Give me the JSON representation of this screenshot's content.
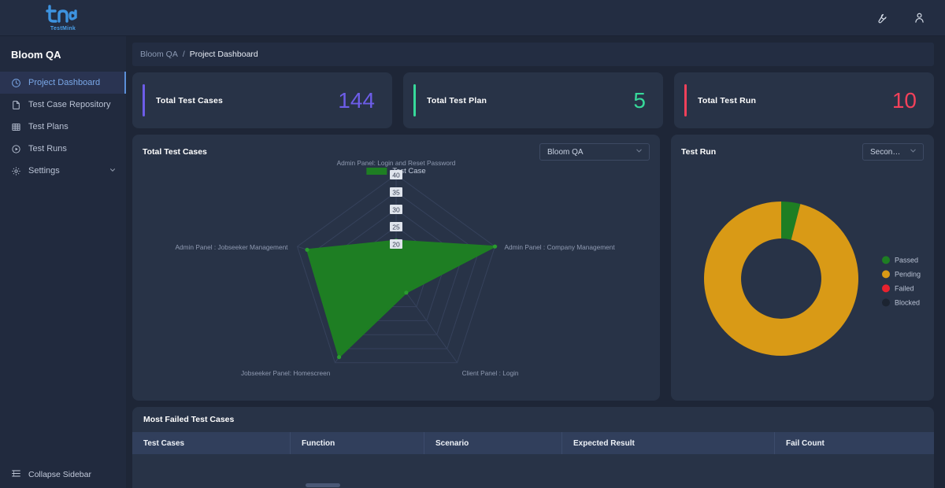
{
  "brand": {
    "name": "TestMink",
    "logo_icon": "testmink-logo-icon"
  },
  "topbar": {
    "tools_icon": "wrench-icon",
    "profile_icon": "user-icon"
  },
  "sidebar": {
    "project_title": "Bloom QA",
    "items": [
      {
        "label": "Project Dashboard",
        "icon": "dashboard-clock-icon",
        "active": true
      },
      {
        "label": "Test Case Repository",
        "icon": "file-icon",
        "active": false
      },
      {
        "label": "Test Plans",
        "icon": "grid-table-icon",
        "active": false
      },
      {
        "label": "Test Runs",
        "icon": "play-circle-icon",
        "active": false
      },
      {
        "label": "Settings",
        "icon": "gear-icon",
        "active": false,
        "expandable": true
      }
    ],
    "collapse_label": "Collapse Sidebar",
    "collapse_icon": "collapse-list-icon"
  },
  "breadcrumb": {
    "root": "Bloom QA",
    "separator": "/",
    "current": "Project Dashboard"
  },
  "cards": [
    {
      "label": "Total Test Cases",
      "value": "144",
      "color": "#6d5de8"
    },
    {
      "label": "Total Test Plan",
      "value": "5",
      "color": "#37d99a"
    },
    {
      "label": "Total Test Run",
      "value": "10",
      "color": "#f2415a"
    }
  ],
  "radar_panel": {
    "title": "Total Test Cases",
    "dropdown": {
      "value": "Bloom QA",
      "icon": "chevron-down-icon"
    }
  },
  "donut_panel": {
    "title": "Test Run",
    "dropdown": {
      "value": "Second R...",
      "icon": "chevron-down-icon"
    }
  },
  "table": {
    "title": "Most Failed Test Cases",
    "columns": [
      "Test Cases",
      "Function",
      "Scenario",
      "Expected Result",
      "Fail Count"
    ],
    "rows": []
  },
  "chart_data": [
    {
      "type": "radar",
      "title": "Total Test Cases",
      "legend": [
        "Test Case"
      ],
      "legend_position": "top-center",
      "series_color": "#1e7e23",
      "categories": [
        "Admin Panel: Login and Reset Password",
        "Admin Panel : Company Management",
        "Client Panel : Login",
        "Jobseeker Panel: Homescreen",
        "Admin Panel : Jobseeker Management"
      ],
      "series": [
        {
          "name": "Test Case",
          "values": [
            21,
            40,
            15,
            38,
            37
          ]
        }
      ],
      "tick_labels": [
        "20",
        "25",
        "30",
        "35",
        "40"
      ],
      "ticks": [
        20,
        25,
        30,
        35,
        40
      ],
      "rlim": [
        15,
        40
      ],
      "grid": true
    },
    {
      "type": "pie",
      "variant": "donut",
      "title": "Test Run",
      "labels": [
        "Passed",
        "Pending",
        "Failed",
        "Blocked"
      ],
      "values": [
        4,
        96,
        0,
        0
      ],
      "colors": [
        "#1e7e23",
        "#d99a16",
        "#e8222e",
        "#1c2431"
      ],
      "legend_position": "right",
      "hole": 0.52
    }
  ]
}
